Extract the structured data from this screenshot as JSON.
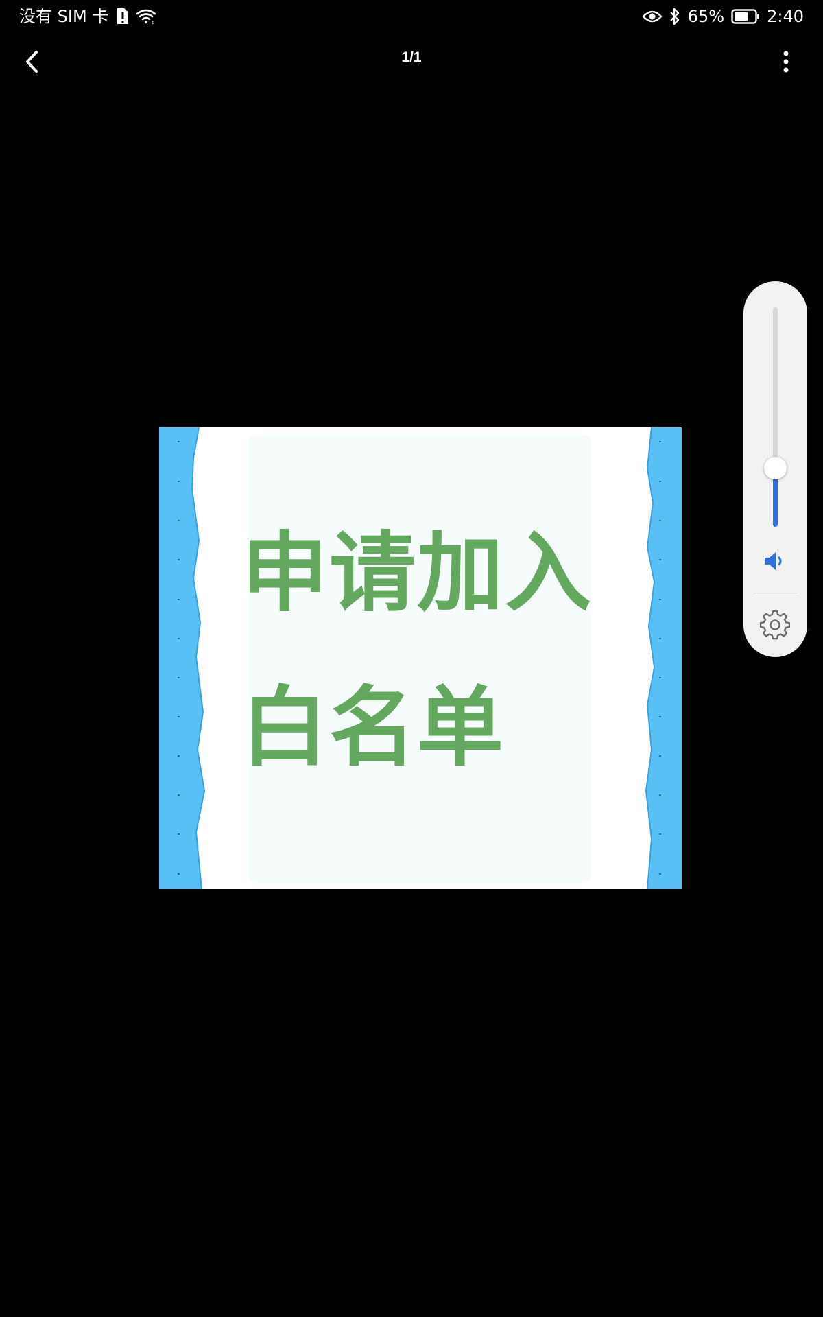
{
  "status_bar": {
    "carrier": "没有 SIM 卡",
    "battery": "65%",
    "time": "2:40",
    "icons": [
      "sim-alert-icon",
      "wifi-icon",
      "eye-icon",
      "bluetooth-icon",
      "battery-icon"
    ]
  },
  "toolbar": {
    "page_indicator": "1/1",
    "back_icon": "chevron-left-icon",
    "more_icon": "more-vertical-icon"
  },
  "image": {
    "line1": "申请加入",
    "line2": "白名单",
    "colors": {
      "text": "#63a85e",
      "border": "#58c0f5",
      "background": "#ffffff"
    }
  },
  "volume_panel": {
    "level": 0.27,
    "accent": "#2f6fe0",
    "speaker_icon": "speaker-icon",
    "settings_icon": "gear-icon"
  }
}
